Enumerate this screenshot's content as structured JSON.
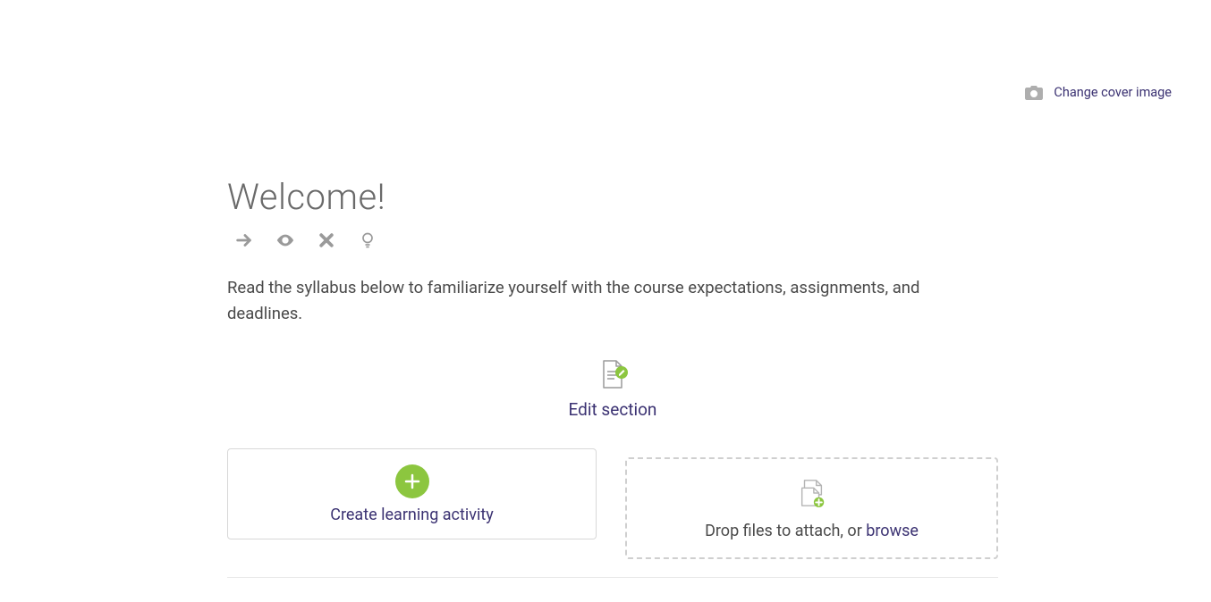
{
  "cover": {
    "change_label": "Change cover image"
  },
  "page": {
    "title": "Welcome!",
    "description": "Read the syllabus below to familiarize yourself with the course expectations, assignments, and deadlines."
  },
  "edit_section": {
    "label": "Edit section"
  },
  "create_activity": {
    "label": "Create learning activity"
  },
  "dropzone": {
    "text": "Drop files to attach, or ",
    "browse": "browse"
  },
  "colors": {
    "accent_green": "#8cc63f",
    "link_purple": "#3b3272"
  }
}
